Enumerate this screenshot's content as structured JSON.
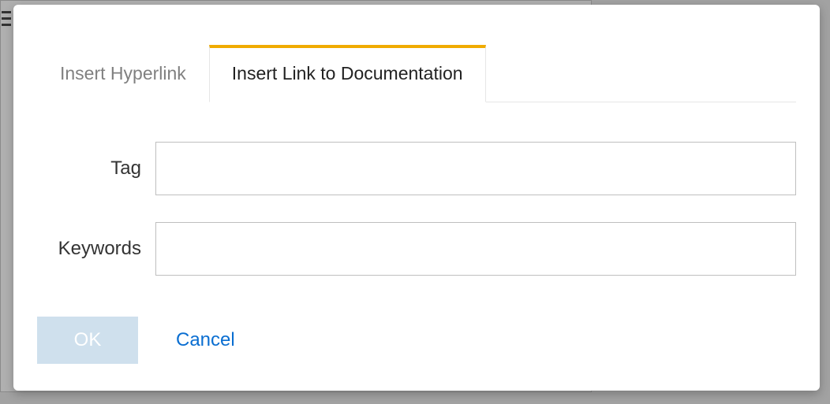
{
  "tabs": {
    "hyperlink": "Insert Hyperlink",
    "documentation": "Insert Link to Documentation"
  },
  "form": {
    "tag_label": "Tag",
    "tag_value": "",
    "keywords_label": "Keywords",
    "keywords_value": ""
  },
  "actions": {
    "ok": "OK",
    "cancel": "Cancel"
  }
}
